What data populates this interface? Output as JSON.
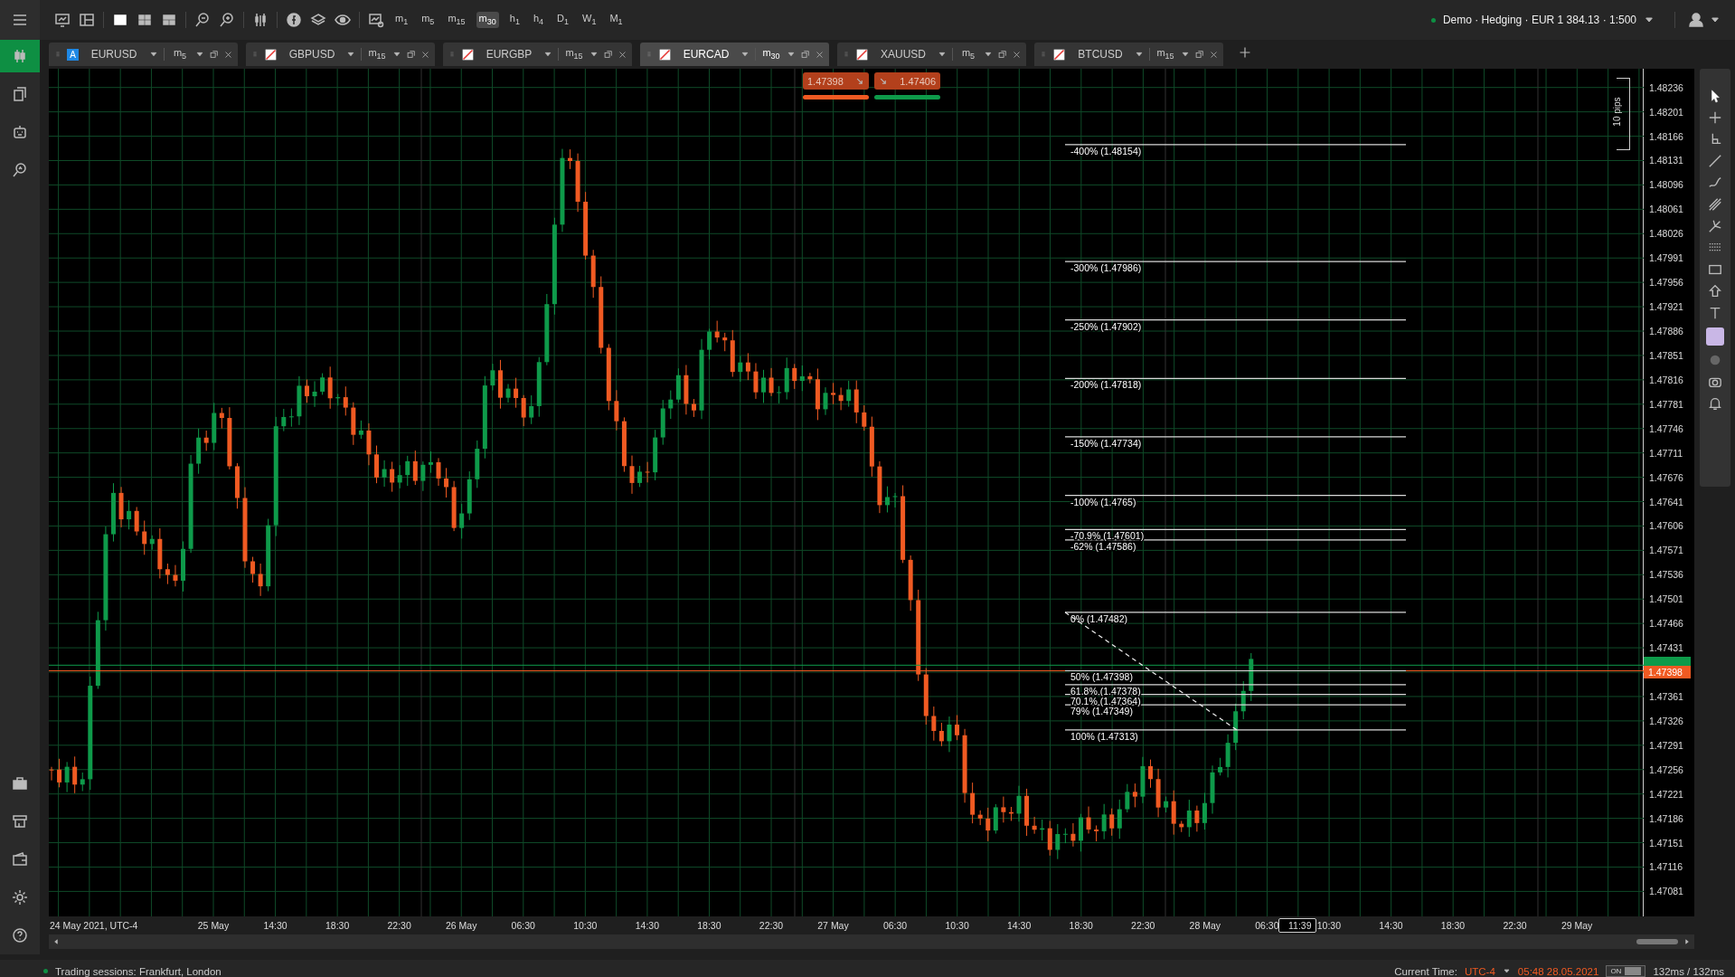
{
  "topbar": {
    "account": "Demo · Hedging · EUR 1 384.13 · 1:500",
    "connected": true,
    "timeframes": [
      {
        "label": "m$_{1}$",
        "selected": false
      },
      {
        "label": "m$_{5}$",
        "selected": false
      },
      {
        "label": "m$_{15}$",
        "selected": false
      },
      {
        "label": "m$_{30}$",
        "selected": true
      },
      {
        "label": "h$_{1}$",
        "selected": false
      },
      {
        "label": "h$_{4}$",
        "selected": false
      },
      {
        "label": "D$_{1}$",
        "selected": false
      },
      {
        "label": "W$_{1}$",
        "selected": false
      },
      {
        "label": "M$_{1}$",
        "selected": false
      }
    ]
  },
  "sidebar": {
    "items": [
      {
        "selected": true
      },
      {
        "selected": false
      },
      {
        "selected": false
      },
      {
        "selected": false
      }
    ]
  },
  "tabs": [
    {
      "symbol": "EURUSD",
      "kind": "letter",
      "icon_text": "A",
      "timeframe": "m$_{5}$",
      "selected": false
    },
    {
      "symbol": "GBPUSD",
      "kind": "flag",
      "timeframe": "m$_{15}$",
      "selected": false
    },
    {
      "symbol": "EURGBP",
      "kind": "flag",
      "timeframe": "m$_{15}$",
      "selected": false
    },
    {
      "symbol": "EURCAD",
      "kind": "flag",
      "timeframe": "m$_{30}$",
      "selected": true
    },
    {
      "symbol": "XAUUSD",
      "kind": "flag",
      "timeframe": "m$_{5}$",
      "selected": false
    },
    {
      "symbol": "BTCUSD",
      "kind": "flag",
      "timeframe": "m$_{15}$",
      "selected": false
    }
  ],
  "chart": {
    "sell_price": "1.47398",
    "buy_price": "1.47406",
    "scale_label": "10 pips",
    "current_price": "1.47398",
    "price_ticks": [
      "1.48236",
      "1.48201",
      "1.48166",
      "1.48131",
      "1.48096",
      "1.48061",
      "1.48026",
      "1.47991",
      "1.47956",
      "1.47921",
      "1.47886",
      "1.47851",
      "1.47816",
      "1.47781",
      "1.47746",
      "1.47711",
      "1.47676",
      "1.47641",
      "1.47606",
      "1.47571",
      "1.47536",
      "1.47501",
      "1.47466",
      "1.47431",
      "1.47361",
      "1.47326",
      "1.47291",
      "1.47256",
      "1.47221",
      "1.47186",
      "1.47151",
      "1.47116",
      "1.47081"
    ],
    "fib_levels": [
      "-400% (1.48154)",
      "-300% (1.47986)",
      "-250% (1.47902)",
      "-200% (1.47818)",
      "-150% (1.47734)",
      "-100% (1.4765)",
      "-70.9% (1.47601)",
      "-62% (1.47586)",
      "0% (1.47482)",
      "50% (1.47398)",
      "61.8% (1.47378)",
      "70.1% (1.47364)",
      "79% (1.47349)",
      "100% (1.47313)"
    ],
    "time_start": "24 May 2021, UTC-4",
    "time_labels": [
      "25 May",
      "14:30",
      "18:30",
      "22:30",
      "26 May",
      "06:30",
      "10:30",
      "14:30",
      "18:30",
      "22:30",
      "27 May",
      "06:30",
      "10:30",
      "14:30",
      "18:30",
      "22:30",
      "28 May",
      "06:30",
      "10:30",
      "14:30",
      "18:30",
      "22:30",
      "29 May"
    ],
    "cursor_time": "11:39"
  },
  "status_bar": {
    "sessions": "Trading sessions: Frankfurt, London",
    "time_label": "Current Time:",
    "timezone": "UTC-4",
    "time": "05:48 28.05.2021",
    "toggle_label": "ON",
    "toggle_on": true,
    "latency": "132ms / 132ms"
  }
}
